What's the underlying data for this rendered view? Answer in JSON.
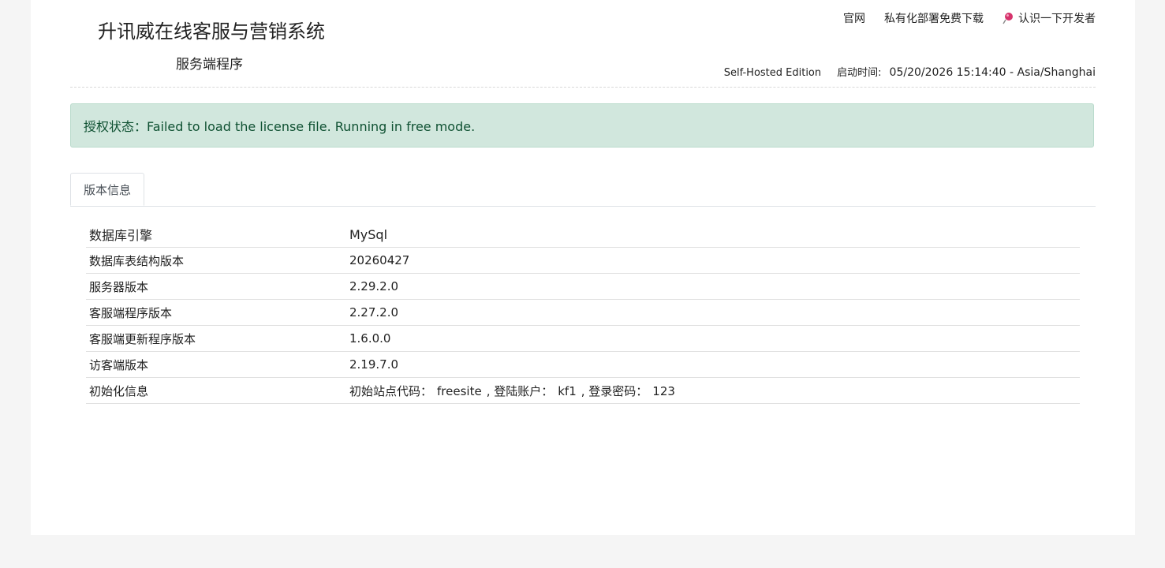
{
  "header": {
    "title": "升讯威在线客服与营销系统",
    "subtitle": "服务端程序",
    "nav": {
      "official_site": "官网",
      "private_deploy": "私有化部署免费下载",
      "developer": "认识一下开发者"
    },
    "edition": "Self-Hosted Edition",
    "start_time_label": "启动时间:",
    "start_time_value": "05/20/2026 15:14:40 - Asia/Shanghai"
  },
  "alert": {
    "text": "授权状态：Failed to load the license file. Running in free mode."
  },
  "tabs": [
    {
      "label": "版本信息",
      "active": true
    }
  ],
  "version_info": {
    "rows": [
      {
        "key": "数据库引擎",
        "value": "MySql"
      },
      {
        "key": "数据库表结构版本",
        "value": "20260427"
      },
      {
        "key": "服务器版本",
        "value": "2.29.2.0"
      },
      {
        "key": "客服端程序版本",
        "value": "2.27.2.0"
      },
      {
        "key": "客服端更新程序版本",
        "value": "1.6.0.0"
      },
      {
        "key": "访客端版本",
        "value": "2.19.7.0"
      }
    ],
    "init": {
      "key": "初始化信息",
      "site_code_label": "初始站点代码：",
      "site_code": "freesite",
      "account_label": ", 登陆账户：",
      "account": "kf1",
      "password_label": ", 登录密码：",
      "password": "123"
    }
  },
  "colors": {
    "alert_bg": "#d1e7dd",
    "alert_text": "#0f5132",
    "page_bg": "#f5f5f5",
    "pin_icon": "#d6336c"
  },
  "icons": {
    "developer": "pushpin-icon"
  }
}
